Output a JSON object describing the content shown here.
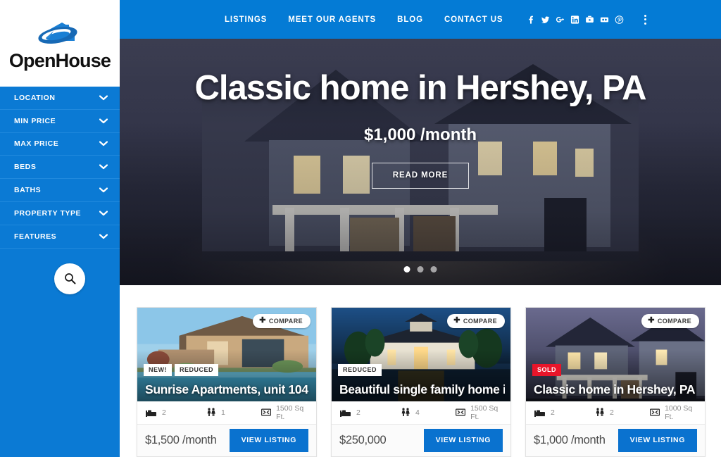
{
  "brand": {
    "name": "OpenHouse",
    "logo_icon": "house-swoosh-logo"
  },
  "sidebar": {
    "filters": [
      {
        "label": "LOCATION",
        "icon": "chevron-down-icon"
      },
      {
        "label": "MIN PRICE",
        "icon": "chevron-down-icon"
      },
      {
        "label": "MAX PRICE",
        "icon": "chevron-down-icon"
      },
      {
        "label": "BEDS",
        "icon": "chevron-down-icon"
      },
      {
        "label": "BATHS",
        "icon": "chevron-down-icon"
      },
      {
        "label": "PROPERTY TYPE",
        "icon": "chevron-down-icon"
      },
      {
        "label": "FEATURES",
        "icon": "chevron-down-icon"
      }
    ],
    "search_icon": "search-icon",
    "background_color": "#0b7ad4"
  },
  "header": {
    "background_color": "#047bd5",
    "nav": [
      {
        "label": "LISTINGS"
      },
      {
        "label": "MEET OUR AGENTS"
      },
      {
        "label": "BLOG"
      },
      {
        "label": "CONTACT US"
      }
    ],
    "social": [
      {
        "icon": "facebook-icon"
      },
      {
        "icon": "twitter-icon"
      },
      {
        "icon": "google-plus-icon"
      },
      {
        "icon": "linkedin-icon"
      },
      {
        "icon": "youtube-icon"
      },
      {
        "icon": "flickr-icon"
      },
      {
        "icon": "pinterest-icon"
      }
    ],
    "menu_icon": "kebab-menu-icon"
  },
  "hero": {
    "title": "Classic home in Hershey, PA",
    "price": "$1,000 /month",
    "cta_label": "READ MORE",
    "slides": 3,
    "active_slide": 1
  },
  "listings": [
    {
      "compare_label": "COMPARE",
      "compare_icon": "plus-icon",
      "badges": [
        {
          "label": "NEW!",
          "style": "light"
        },
        {
          "label": "REDUCED",
          "style": "light"
        }
      ],
      "title": "Sunrise Apartments, unit 104",
      "beds": "2",
      "baths": "1",
      "area": "1500 Sq Ft.",
      "price": "$1,500 /month",
      "cta_label": "VIEW LISTING"
    },
    {
      "compare_label": "COMPARE",
      "compare_icon": "plus-icon",
      "badges": [
        {
          "label": "REDUCED",
          "style": "light"
        }
      ],
      "title": "Beautiful single family home in NY",
      "beds": "2",
      "baths": "4",
      "area": "1500 Sq Ft.",
      "price": "$250,000",
      "cta_label": "VIEW LISTING"
    },
    {
      "compare_label": "COMPARE",
      "compare_icon": "plus-icon",
      "badges": [
        {
          "label": "SOLD",
          "style": "sold"
        }
      ],
      "title": "Classic home in Hershey, PA",
      "beds": "2",
      "baths": "2",
      "area": "1000 Sq Ft.",
      "price": "$1,000 /month",
      "cta_label": "VIEW LISTING"
    }
  ],
  "colors": {
    "brand_blue": "#047bd5",
    "sidebar_blue": "#0b7ad4",
    "button_blue": "#0a72cf",
    "sold_red": "#e8152a"
  }
}
